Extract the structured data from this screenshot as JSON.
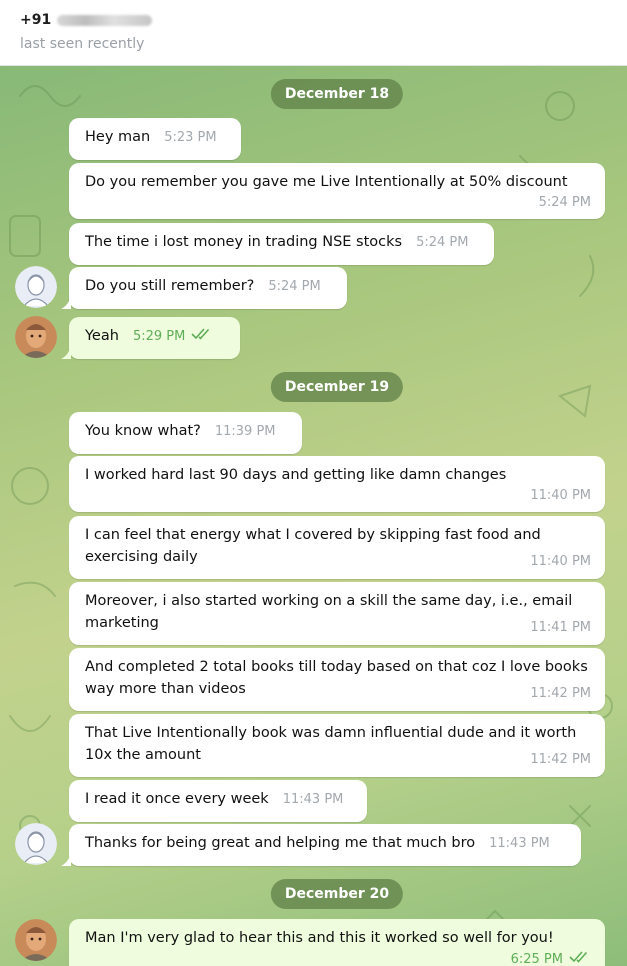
{
  "header": {
    "phone_prefix": "+91",
    "status": "last seen recently"
  },
  "dates": [
    "December 18",
    "December 19",
    "December 20"
  ],
  "messages": [
    {
      "text": "Hey man",
      "time": "5:23 PM"
    },
    {
      "text": "Do you remember you gave me Live Intentionally at 50% discount",
      "time": "5:24 PM"
    },
    {
      "text": "The time i lost money in trading NSE stocks",
      "time": "5:24 PM"
    },
    {
      "text": "Do you still remember?",
      "time": "5:24 PM"
    },
    {
      "text": "Yeah",
      "time": "5:29 PM",
      "read": true
    },
    {
      "text": "You know what?",
      "time": "11:39 PM"
    },
    {
      "text": "I worked hard last 90 days and getting like damn changes",
      "time": "11:40 PM"
    },
    {
      "text": "I can feel that energy what I covered by skipping fast food and exercising daily",
      "time": "11:40 PM"
    },
    {
      "text": "Moreover, i also started working on a skill the same day, i.e., email marketing",
      "time": "11:41 PM"
    },
    {
      "text": "And completed 2 total books till today based on that coz I love books way more than videos",
      "time": "11:42 PM"
    },
    {
      "text": "That Live Intentionally book was damn influential dude and it worth 10x the amount",
      "time": "11:42 PM"
    },
    {
      "text": "I read it once every week",
      "time": "11:43 PM"
    },
    {
      "text": "Thanks for being great and helping me that much bro",
      "time": "11:43 PM"
    },
    {
      "text": "Man I'm very glad to hear this and this it worked so well for you!",
      "time": "6:25 PM",
      "read": true
    }
  ],
  "colors": {
    "incoming_bubble": "#ffffff",
    "outgoing_bubble": "#effdde",
    "outgoing_time": "#5fae57",
    "date_pill": "#608048"
  },
  "icons": {
    "read_receipt": "double-check-icon",
    "contact_avatar": "contact-avatar",
    "own_avatar": "own-avatar"
  }
}
